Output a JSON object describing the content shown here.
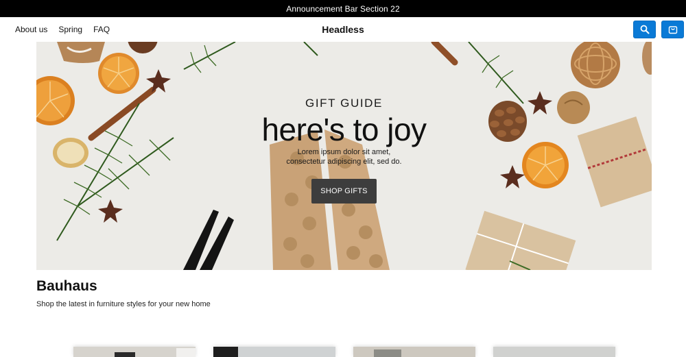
{
  "announcement": {
    "text": "Announcement Bar Section 22"
  },
  "header": {
    "nav": [
      {
        "label": "About us"
      },
      {
        "label": "Spring"
      },
      {
        "label": "FAQ"
      }
    ],
    "brand": "Headless",
    "search_icon": "search-icon",
    "cart_icon": "shopping-bag-icon",
    "accent_color": "#0a7ad6"
  },
  "hero": {
    "eyebrow": "GIFT GUIDE",
    "headline": "here's to joy",
    "subcopy_line1": "Lorem ipsum dolor sit amet,",
    "subcopy_line2": "consectetur adipiscing elit, sed do.",
    "cta_label": "SHOP GIFTS"
  },
  "section": {
    "title": "Bauhaus",
    "subtitle": "Shop the latest in furniture styles for your new home"
  },
  "products": [
    {
      "image": "product-image"
    },
    {
      "image": "product-image"
    },
    {
      "image": "product-image"
    },
    {
      "image": "product-image"
    }
  ]
}
